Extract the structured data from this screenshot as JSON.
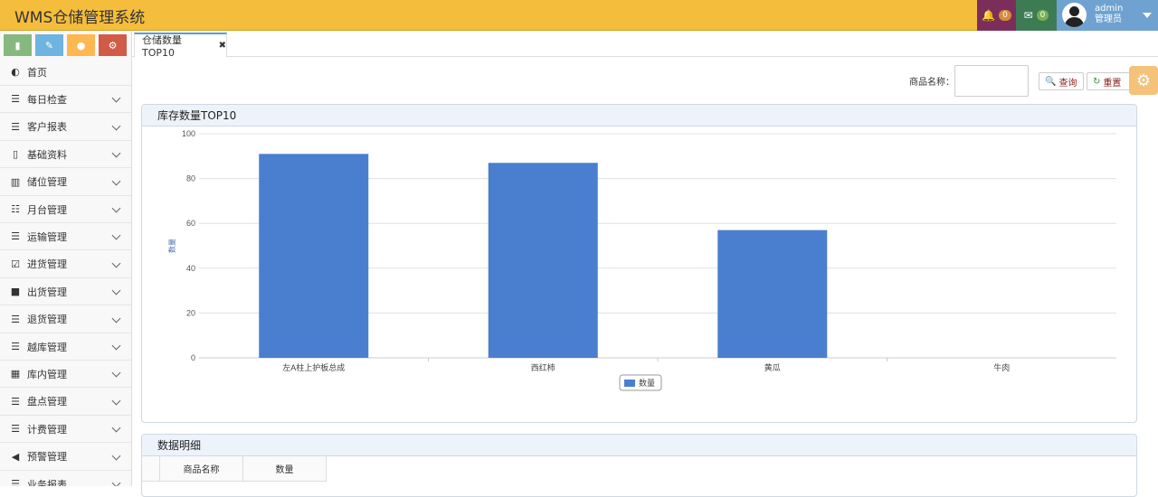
{
  "header": {
    "title": "WMS仓储管理系统",
    "notif_count": "0",
    "mail_count": "0",
    "user_name": "admin",
    "user_role": "管理员"
  },
  "sidebar": {
    "items": [
      {
        "label": "首页",
        "icon": "dashboard-icon"
      },
      {
        "label": "每日检查",
        "icon": "list-icon"
      },
      {
        "label": "客户报表",
        "icon": "list-icon"
      },
      {
        "label": "基础资料",
        "icon": "file-icon"
      },
      {
        "label": "储位管理",
        "icon": "building-icon"
      },
      {
        "label": "月台管理",
        "icon": "th-list-icon"
      },
      {
        "label": "运输管理",
        "icon": "list-icon"
      },
      {
        "label": "进货管理",
        "icon": "check-square-icon"
      },
      {
        "label": "出货管理",
        "icon": "truck-icon"
      },
      {
        "label": "退货管理",
        "icon": "list-icon"
      },
      {
        "label": "越库管理",
        "icon": "list-icon"
      },
      {
        "label": "库内管理",
        "icon": "film-icon"
      },
      {
        "label": "盘点管理",
        "icon": "list-icon"
      },
      {
        "label": "计费管理",
        "icon": "list-icon"
      },
      {
        "label": "预警管理",
        "icon": "volume-icon"
      },
      {
        "label": "业务报表",
        "icon": "list-icon"
      }
    ]
  },
  "tabs": {
    "active_label": "仓储数量TOP10"
  },
  "search": {
    "label": "商品名称：",
    "query_label": "查询",
    "reset_label": "重置"
  },
  "chart_panel": {
    "title": "库存数量TOP10"
  },
  "detail_panel": {
    "title": "数据明细",
    "columns": [
      "商品名称",
      "数量"
    ]
  },
  "colors": {
    "bar": "#4a7fd0",
    "header": "#f5bd3c"
  },
  "chart_data": {
    "type": "bar",
    "categories": [
      "左A柱上护板总成",
      "西红柿",
      "黄瓜",
      "牛肉"
    ],
    "series": [
      {
        "name": "数量",
        "values": [
          91,
          87,
          57,
          0
        ]
      }
    ],
    "ylabel": "数量",
    "ylim": [
      0,
      100
    ],
    "yticks": [
      0,
      20,
      40,
      60,
      80,
      100
    ],
    "legend": "bottom-center",
    "grid": true
  }
}
